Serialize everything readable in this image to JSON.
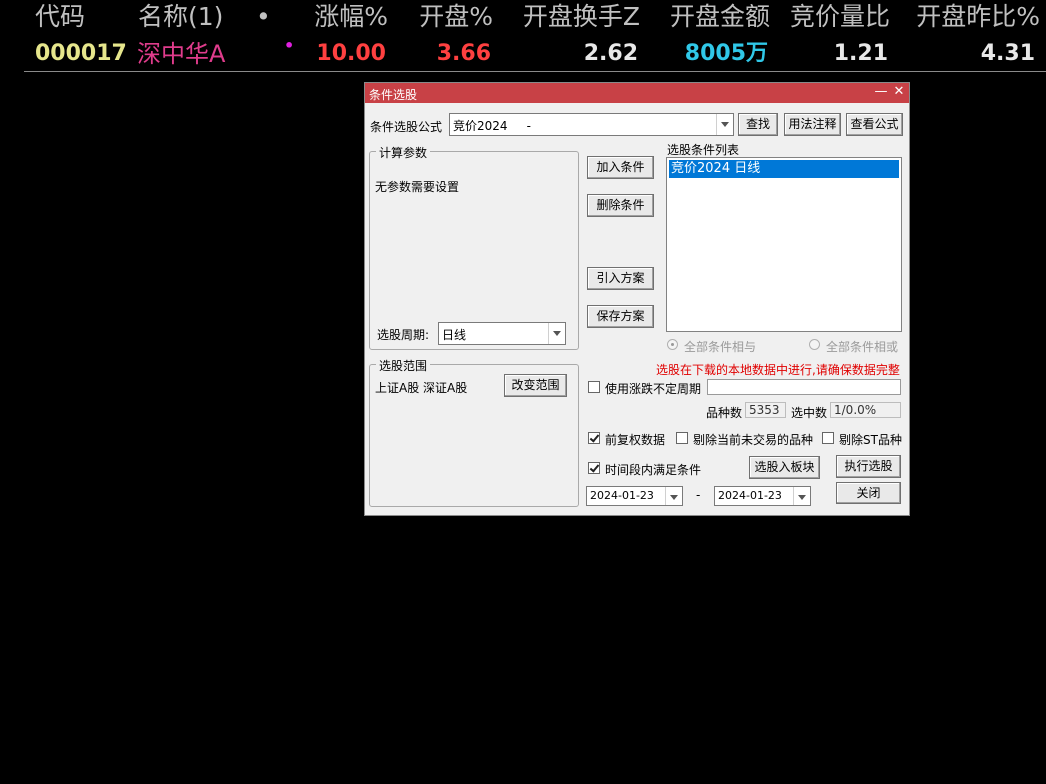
{
  "table": {
    "headers": [
      "代码",
      "名称(1)",
      "•",
      "涨幅%",
      "开盘%",
      "开盘换手Z",
      "开盘金额",
      "竞价量比",
      "开盘昨比%"
    ],
    "row": {
      "code": "000017",
      "name": "深中华A",
      "marker": "•",
      "change_pct": "10.00",
      "open_pct": "3.66",
      "open_turnover": "2.62",
      "open_amount": "8005万",
      "auction_vol_ratio": "1.21",
      "open_vs_prev": "4.31"
    }
  },
  "colors": {
    "header_text": "#c0c0c0",
    "code": "#e6e68c",
    "name": "#e03c8c",
    "marker": "#e020e0",
    "up_red": "#ff4040",
    "white": "#e8e8e8",
    "cyan": "#30c8e8",
    "title_bar": "#c84146",
    "warning": "#e00000",
    "selection": "#0078d7"
  },
  "dialog": {
    "title": "条件选股",
    "minimize_glyph": "—",
    "close_glyph": "✕",
    "formula_label": "条件选股公式",
    "formula_value": "竞价2024     -",
    "find_button": "查找",
    "usage_button": "用法注释",
    "view_formula_button": "查看公式",
    "calc_params_title": "计算参数",
    "no_params_text": "无参数需要设置",
    "period_label": "选股周期:",
    "period_value": "日线",
    "add_condition_button": "加入条件",
    "delete_condition_button": "删除条件",
    "import_scheme_button": "引入方案",
    "save_scheme_button": "保存方案",
    "condition_list_label": "选股条件列表",
    "condition_items": [
      "竞价2024  日线"
    ],
    "radio_and_label": "全部条件相与",
    "radio_or_label": "全部条件相或",
    "range_title": "选股范围",
    "range_value": "上证A股 深证A股",
    "change_range_button": "改变范围",
    "warning_text": "选股在下载的本地数据中进行,请确保数据完整",
    "use_variable_period_label": "使用涨跌不定周期",
    "variable_period_value": "",
    "count_label": "品种数",
    "count_value": "5353",
    "selected_label": "选中数",
    "selected_value": "1/0.0%",
    "forward_adjust_label": "前复权数据",
    "forward_adjust_checked": true,
    "exclude_untraded_label": "剔除当前未交易的品种",
    "exclude_untraded_checked": false,
    "exclude_st_label": "剔除ST品种",
    "exclude_st_checked": false,
    "time_range_label": "时间段内满足条件",
    "time_range_checked": true,
    "add_to_block_button": "选股入板块",
    "execute_button": "执行选股",
    "start_date": "2024-01-23",
    "date_separator": "-",
    "end_date": "2024-01-23",
    "close_button": "关闭"
  }
}
